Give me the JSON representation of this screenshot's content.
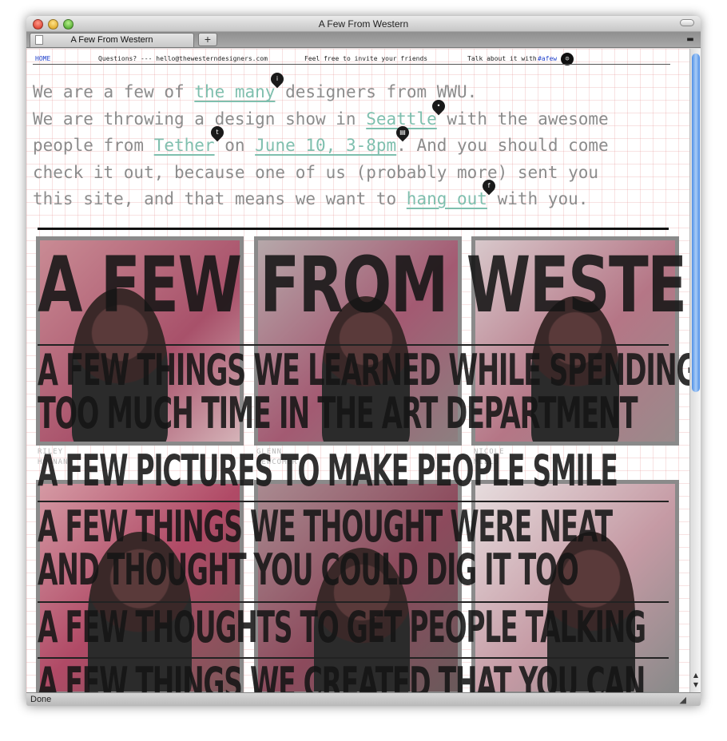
{
  "window": {
    "title": "A Few From Western",
    "tab_label": "A Few From Western",
    "new_tab_symbol": "+",
    "status": "Done"
  },
  "nav": {
    "home": "HOME",
    "questions": "Questions? --- hello@thewesterndesigners.com",
    "invite": "Feel free to invite your friends",
    "talk": "Talk about it with",
    "hashtag": "#afew"
  },
  "intro": {
    "l1_a": "We are a few of ",
    "l1_link": "the many",
    "l1_b": " designers from WWU.",
    "l2_a": "We are throwing a design show in ",
    "l2_link": "Seattle",
    "l2_b": " with the awesome",
    "l3_a": "people from ",
    "l3_link1": "Tether",
    "l3_b": " on ",
    "l3_link2": "June 10, 3-8pm",
    "l3_c": ". And you should come",
    "l4": "check it out, because one of us (probably more) sent you",
    "l5_a": "this site, and that means we want to ",
    "l5_link": "hang out",
    "l5_b": " with you."
  },
  "markers": {
    "m1": "i",
    "m2": "•",
    "m3": "t",
    "m4": "▤",
    "m5": "f"
  },
  "people": [
    {
      "first": "RILEY",
      "last": "HOGNAN"
    },
    {
      "first": "GLENN",
      "last": "NEWCOMER"
    },
    {
      "first": "NICOLE",
      "last": "MILLS"
    }
  ],
  "headlines": {
    "h1": "A FEW FROM WESTERN",
    "h2a": "A FEW THINGS WE LEARNED WHILE SPENDING",
    "h2b": "TOO MUCH TIME IN THE ART DEPARTMENT",
    "h3": "A FEW PICTURES TO MAKE PEOPLE SMILE",
    "h4a": "A FEW THINGS WE THOUGHT WERE NEAT",
    "h4b": "AND THOUGHT YOU COULD DIG IT TOO",
    "h5": "A FEW THOUGHTS TO GET PEOPLE TALKING",
    "h6": "A FEW THINGS WE CREATED THAT YOU CAN"
  },
  "colors": {
    "link": "#7fbfae",
    "body_text": "#8c8c8c",
    "nav_link": "#2244cc",
    "scroll_thumb": "#4d8ee6"
  }
}
